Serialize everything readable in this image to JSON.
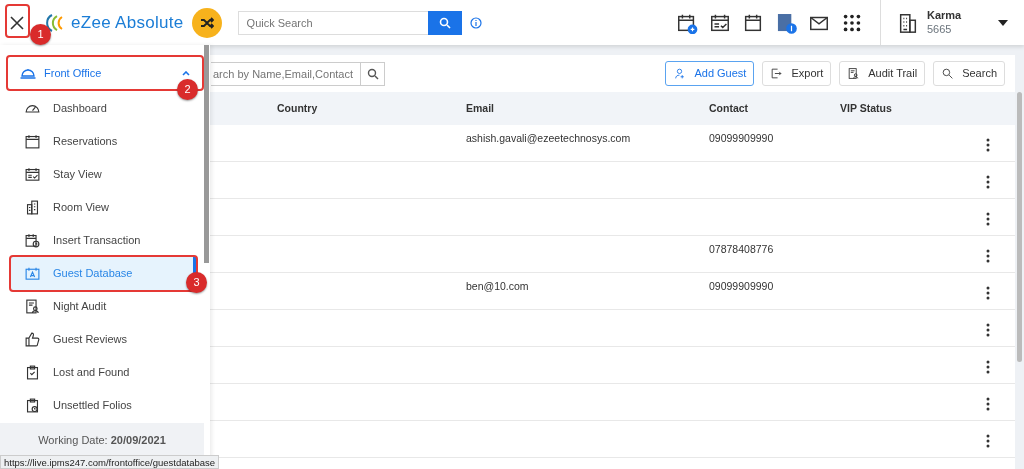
{
  "header": {
    "brand": "eZee Absolute",
    "quick_search": {
      "placeholder": "Quick Search"
    },
    "property": {
      "name": "Karma",
      "code": "5665"
    }
  },
  "sidebar": {
    "section": {
      "label": "Front Office",
      "expanded": true
    },
    "items": [
      {
        "label": "Dashboard",
        "selected": false
      },
      {
        "label": "Reservations",
        "selected": false
      },
      {
        "label": "Stay View",
        "selected": false
      },
      {
        "label": "Room View",
        "selected": false
      },
      {
        "label": "Insert Transaction",
        "selected": false
      },
      {
        "label": "Guest Database",
        "selected": true
      },
      {
        "label": "Night Audit",
        "selected": false
      },
      {
        "label": "Guest Reviews",
        "selected": false
      },
      {
        "label": "Lost and Found",
        "selected": false
      },
      {
        "label": "Unsettled Folios",
        "selected": false
      }
    ],
    "working_date": "Working Date: **20/09/2021**"
  },
  "toolbar": {
    "search": {
      "placeholder": "arch by Name,Email,Contact"
    },
    "buttons": [
      {
        "label": "Add Guest",
        "kind": "add"
      },
      {
        "label": "Export",
        "kind": "export"
      },
      {
        "label": "Audit Trail",
        "kind": "audit"
      },
      {
        "label": "Search",
        "kind": "search"
      }
    ]
  },
  "table": {
    "columns": [
      "Country",
      "Email",
      "Contact",
      "VIP Status"
    ],
    "rows": [
      {
        "email": "ashish.gavali@ezeetechnosys.com",
        "contact": "09099909990"
      },
      {},
      {},
      {
        "contact": "07878408776"
      },
      {
        "email": "ben@10.com",
        "contact": "09099909990"
      },
      {},
      {},
      {},
      {}
    ]
  },
  "annotations": [
    {
      "number": "1"
    },
    {
      "number": "2"
    },
    {
      "number": "3"
    }
  ],
  "status_url": "https://live.ipms247.com/frontoffice/guestdatabase"
}
